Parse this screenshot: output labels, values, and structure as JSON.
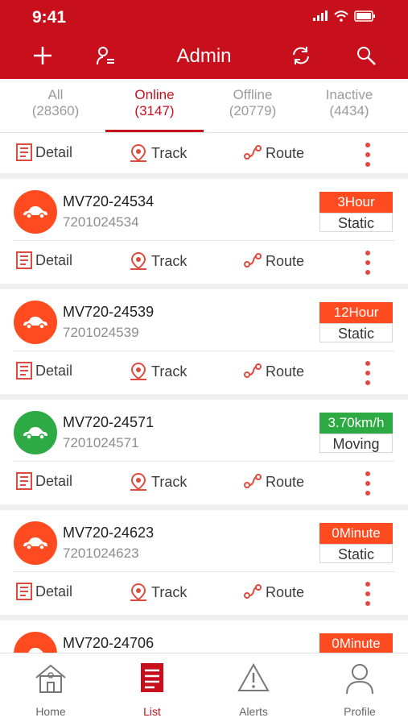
{
  "status_bar": {
    "time": "9:41"
  },
  "header": {
    "title": "Admin"
  },
  "tabs": [
    {
      "label": "All",
      "count": "(28360)"
    },
    {
      "label": "Online",
      "count": "(3147)"
    },
    {
      "label": "Offline",
      "count": "(20779)"
    },
    {
      "label": "Inactive",
      "count": "(4434)"
    }
  ],
  "actions": {
    "detail": "Detail",
    "track": "Track",
    "route": "Route"
  },
  "vehicles": [
    {
      "name": "MV720-24534",
      "imei": "7201024534",
      "badge": "3Hour",
      "status": "Static",
      "color": "#ff4b1f"
    },
    {
      "name": "MV720-24539",
      "imei": "7201024539",
      "badge": "12Hour",
      "status": "Static",
      "color": "#ff4b1f"
    },
    {
      "name": "MV720-24571",
      "imei": "7201024571",
      "badge": "3.70km/h",
      "status": "Moving",
      "color": "#2eaa44"
    },
    {
      "name": "MV720-24623",
      "imei": "7201024623",
      "badge": "0Minute",
      "status": "Static",
      "color": "#ff4b1f"
    },
    {
      "name": "MV720-24706",
      "imei": "",
      "badge": "0Minute",
      "status": "",
      "color": "#ff4b1f"
    }
  ],
  "nav": [
    {
      "label": "Home"
    },
    {
      "label": "List"
    },
    {
      "label": "Alerts"
    },
    {
      "label": "Profile"
    }
  ]
}
